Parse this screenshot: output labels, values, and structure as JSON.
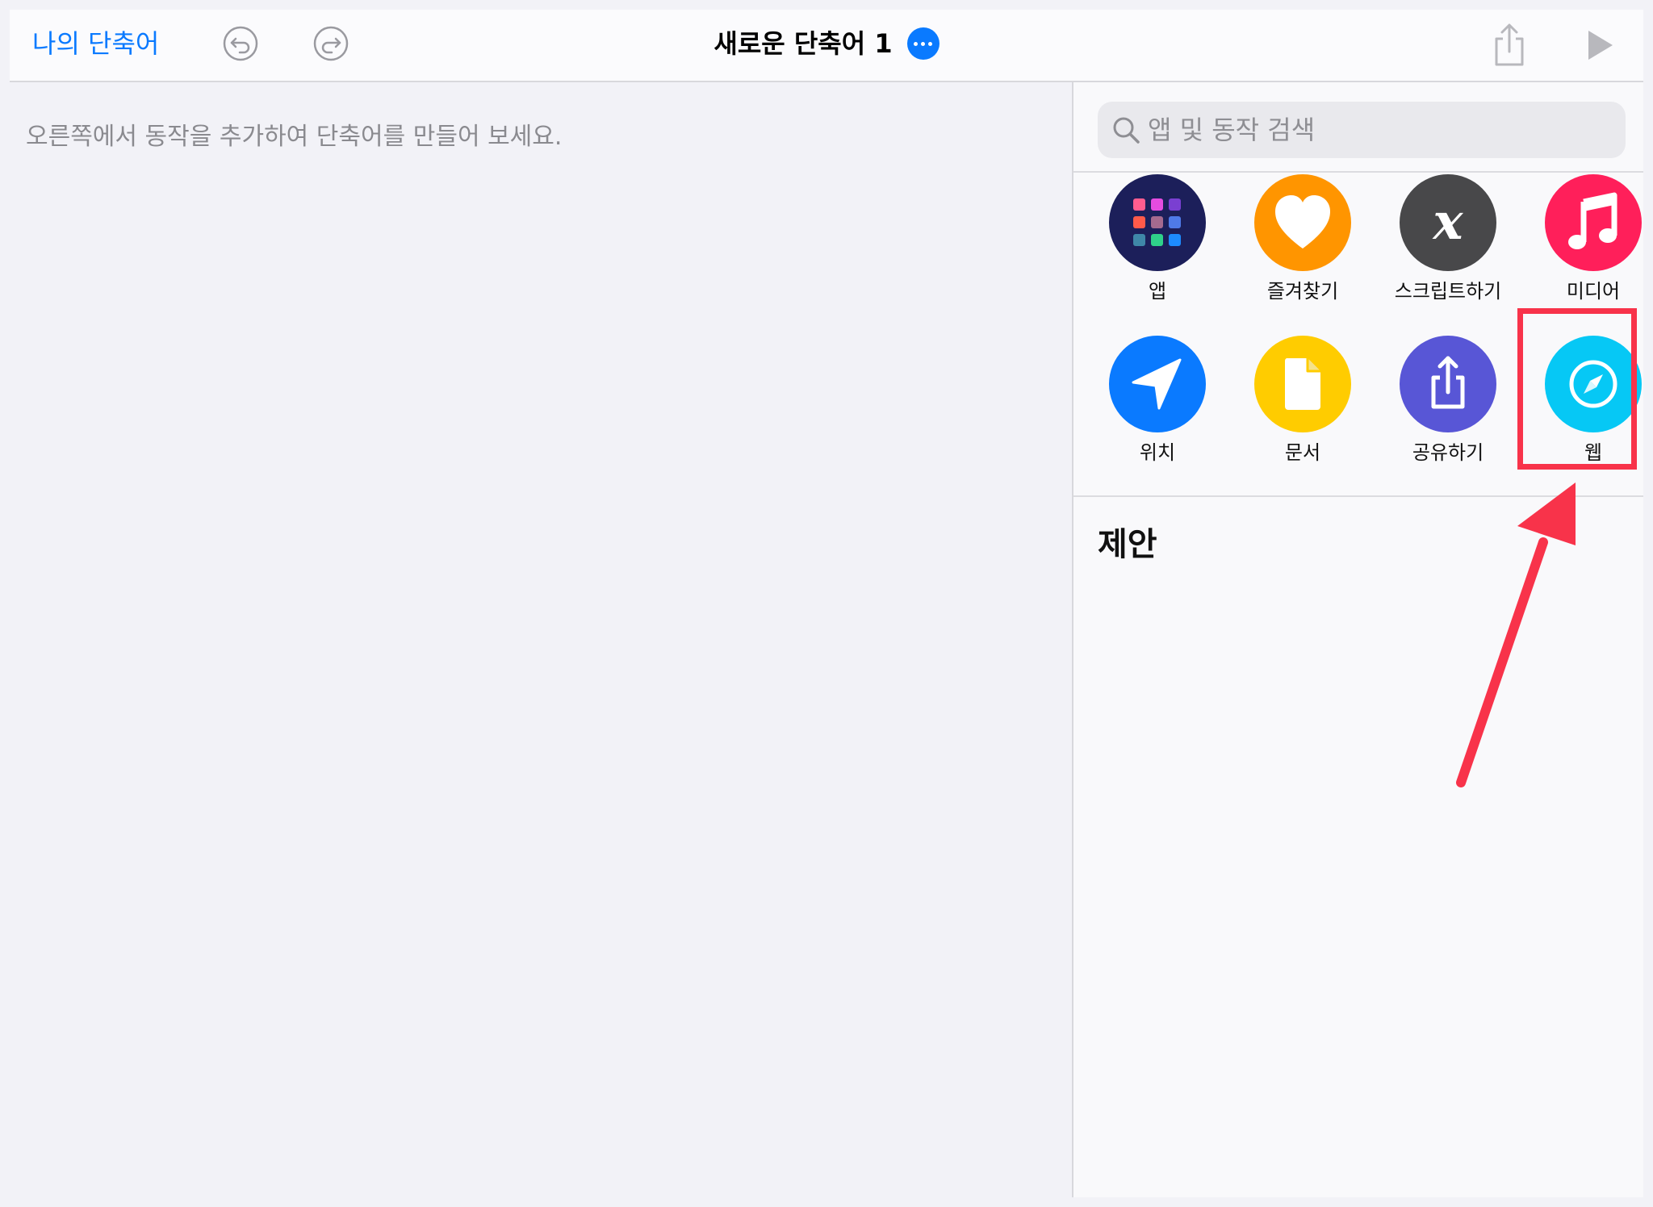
{
  "topbar": {
    "back_label": "나의 단축어",
    "title": "새로운 단축어 1"
  },
  "editor": {
    "hint": "오른쪽에서 동작을 추가하여 단축어를 만들어 보세요."
  },
  "panel": {
    "search_placeholder": "앱 및 동작 검색",
    "categories": [
      {
        "label": "앱",
        "icon": "apps-grid-icon",
        "color": "#1c1f5a"
      },
      {
        "label": "즐겨찾기",
        "icon": "heart-icon",
        "color": "#ff9500"
      },
      {
        "label": "스크립트하기",
        "icon": "script-x-icon",
        "color": "#48484a"
      },
      {
        "label": "미디어",
        "icon": "music-note-icon",
        "color": "#ff1f5a"
      },
      {
        "label": "위치",
        "icon": "location-arrow-icon",
        "color": "#0a7aff"
      },
      {
        "label": "문서",
        "icon": "document-icon",
        "color": "#ffcc00"
      },
      {
        "label": "공유하기",
        "icon": "share-icon",
        "color": "#5856d6"
      },
      {
        "label": "웹",
        "icon": "compass-icon",
        "color": "#06c8f5"
      }
    ],
    "suggestions_title": "제안"
  },
  "annotation": {
    "color": "#f8334a"
  }
}
